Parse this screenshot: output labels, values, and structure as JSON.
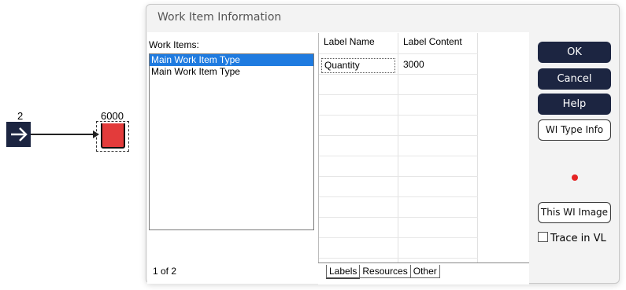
{
  "canvas": {
    "entry_count": "2",
    "queue_count": "6000",
    "entry_color": "#1c2541",
    "queue_color": "#e33b3b"
  },
  "dialog": {
    "title": "Work Item Information",
    "work_items_label": "Work Items:",
    "work_items": [
      "Main Work Item Type",
      "Main Work Item Type"
    ],
    "selected_index": 0,
    "count_text": "1 of 2",
    "table": {
      "headers": [
        "Label Name",
        "Label Content"
      ],
      "rows": [
        {
          "name": "Quantity",
          "content": "3000"
        }
      ]
    },
    "tabs": [
      "Labels",
      "Resources",
      "Other"
    ],
    "active_tab": "Labels",
    "buttons": {
      "ok": "OK",
      "cancel": "Cancel",
      "help": "Help",
      "wi_type_info": "WI Type Info",
      "this_wi_image": "This WI Image"
    },
    "trace_label": "Trace in VL",
    "trace_checked": false,
    "accent_color": "#1c2541",
    "selection_color": "#1f7be0",
    "dot_color": "#e52424"
  }
}
